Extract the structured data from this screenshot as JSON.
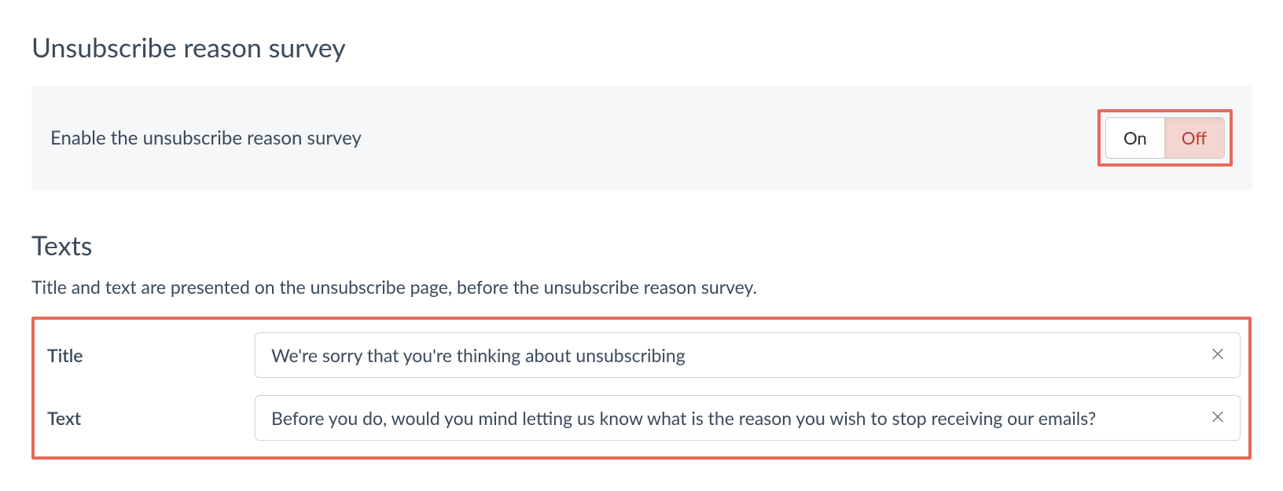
{
  "survey": {
    "title": "Unsubscribe reason survey",
    "enable_label": "Enable the unsubscribe reason survey",
    "toggle": {
      "on": "On",
      "off": "Off",
      "active": "off"
    }
  },
  "texts": {
    "heading": "Texts",
    "description": "Title and text are presented on the unsubscribe page, before the unsubscribe reason survey.",
    "fields": {
      "title_label": "Title",
      "title_value": "We're sorry that you're thinking about unsubscribing",
      "text_label": "Text",
      "text_value": "Before you do, would you mind letting us know what is the reason you wish to stop receiving our emails?"
    }
  }
}
